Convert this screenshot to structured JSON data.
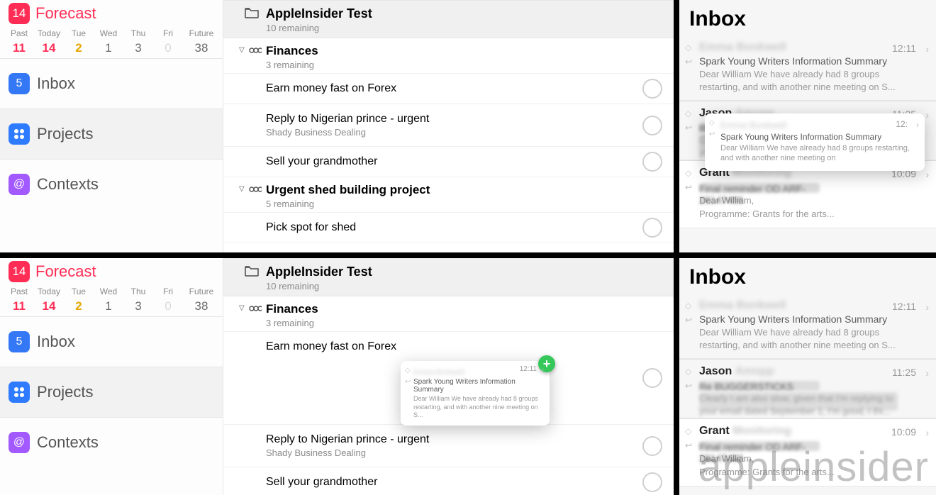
{
  "sidebar": {
    "forecast_badge": "14",
    "forecast_label": "Forecast",
    "days": [
      {
        "name": "Past",
        "num": "11",
        "cls": "d-red"
      },
      {
        "name": "Today",
        "num": "14",
        "cls": "d-red"
      },
      {
        "name": "Tue",
        "num": "2",
        "cls": "d-amber"
      },
      {
        "name": "Wed",
        "num": "1",
        "cls": "d-grey"
      },
      {
        "name": "Thu",
        "num": "3",
        "cls": "d-grey"
      },
      {
        "name": "Fri",
        "num": "0",
        "cls": "d-faint"
      },
      {
        "name": "Future",
        "num": "38",
        "cls": "d-grey"
      }
    ],
    "inbox_badge": "5",
    "inbox_label": "Inbox",
    "projects_label": "Projects",
    "contexts_label": "Contexts"
  },
  "tasks": {
    "group_title": "AppleInsider Test",
    "group_sub": "10 remaining",
    "sections": [
      {
        "title": "Finances",
        "sub": "3 remaining",
        "items": [
          {
            "title": "Earn money fast on Forex"
          },
          {
            "title": "Reply to Nigerian prince - urgent",
            "sub": "Shady Business Dealing"
          },
          {
            "title": "Sell your grandmother"
          }
        ]
      },
      {
        "title": "Urgent shed building project",
        "sub": "5 remaining",
        "items": [
          {
            "title": "Pick spot for shed"
          }
        ]
      }
    ]
  },
  "mail": {
    "title": "Inbox",
    "items": [
      {
        "sender_clear": "",
        "sender_blur": "Emma Bonkwell",
        "time": "12:11",
        "subject": "Spark Young Writers Information Summary",
        "preview": "Dear William We have already had 8 groups restarting, and with another nine meeting on S...",
        "selected": false
      },
      {
        "sender_clear": "Jason",
        "sender_blur": "Amopp",
        "time": "11:25",
        "subject_blur": "Re BUGGERSTICKS",
        "preview_blur": "Clearly I am also slow, given that I'm replying to your email dated September 1, I'm good, I thi...",
        "selected": false
      },
      {
        "sender_clear": "Grant",
        "sender_blur": "Monitoring",
        "time": "10:09",
        "subject_blur": "Final reminder OD ARF-28147456",
        "preview": "Dear William,",
        "preview2": "Programme: Grants for the arts...",
        "selected": true
      }
    ]
  },
  "drag_top": {
    "sender_blur": "Emma Bonkwell",
    "time": "12:",
    "subject": "Spark Young Writers Information Summary",
    "preview": "Dear William We have already had 8 groups restarting, and with another nine meeting on"
  },
  "drag_bottom": {
    "sender_blur": "Emma Bonkwell",
    "time": "12:11",
    "subject": "Spark Young Writers Information Summary",
    "preview": "Dear William We have already had 8 groups restarting, and with another nine meeting on S..."
  },
  "watermark": "appleinsider"
}
